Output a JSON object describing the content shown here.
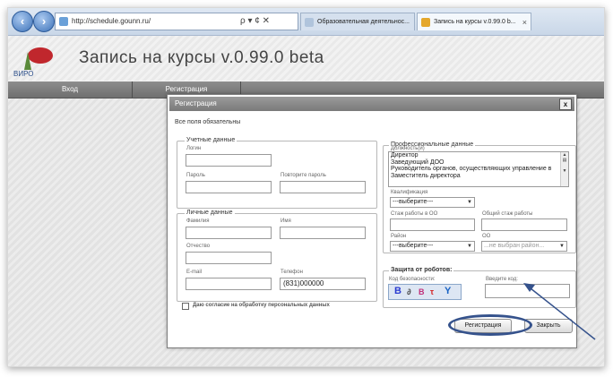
{
  "browser": {
    "address": "http://schedule.gounn.ru/",
    "address_controls": "ρ ▾ ¢ ✕",
    "tabs": [
      {
        "label": "Образовательная деятельнос...",
        "active": false
      },
      {
        "label": "Запись на курсы v.0.99.0 b...",
        "active": true
      }
    ],
    "tab_close": "×"
  },
  "site": {
    "logo_text": "ВИРО",
    "title": "Запись на курсы v.0.99.0 beta"
  },
  "nav": {
    "items": [
      "Вход",
      "Регистрация"
    ]
  },
  "dialog": {
    "title": "Регистрация",
    "close": "x",
    "required_note": "Все поля обязательны",
    "accounts": {
      "legend": "Учетные данные",
      "login_label": "Логин",
      "login_value": "",
      "password_label": "Пароль",
      "password_repeat_label": "Повторите пароль"
    },
    "personal": {
      "legend": "Личные данные",
      "lastname_label": "Фамилия",
      "firstname_label": "Имя",
      "middlename_label": "Отчество",
      "email_label": "E-mail",
      "phone_label": "Телефон",
      "phone_value": "(831)000000"
    },
    "consent_label": "Даю согласие на обработку персональных данных",
    "professional": {
      "legend": "Профессиональные данные",
      "positions_label": "Должность(и)",
      "positions": [
        "Директор",
        "Заведующий ДОО",
        "Руководитель органов, осуществляющих управление в",
        "Заместитель директора"
      ],
      "qualification_label": "Квалификация",
      "qualification_value": "---выберите---",
      "oo_experience_label": "Стаж работы в ОО",
      "total_experience_label": "Общий стаж работы",
      "district_label": "Район",
      "district_value": "---выберите---",
      "oo_label": "ОО",
      "oo_value": "...не выбран район..."
    },
    "robot": {
      "legend": "Защита от роботов:",
      "code_label": "Код безопасности:",
      "captcha_chars": [
        "B",
        "∂",
        "B",
        "τ",
        "Y"
      ],
      "enter_code_label": "Введите код:"
    },
    "buttons": {
      "register": "Регистрация",
      "close": "Закрыть"
    }
  },
  "colors": {
    "annotation": "#35528c",
    "nav_bar": "#7d7d7d",
    "title_bar": "#8a8a8a"
  }
}
